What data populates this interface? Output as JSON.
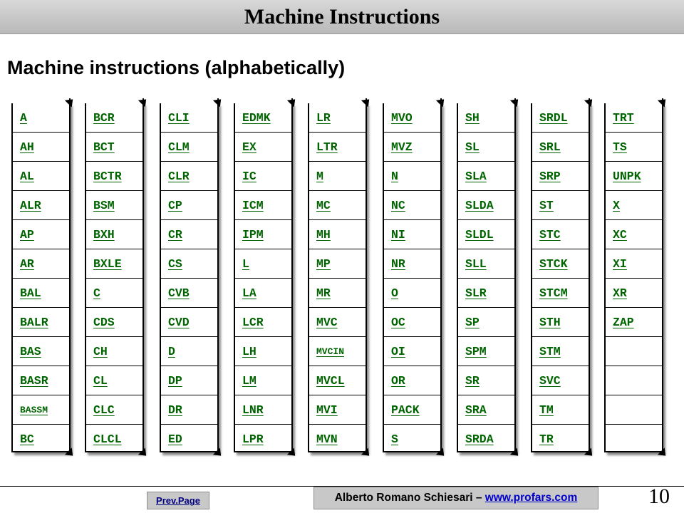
{
  "header": {
    "title": "Machine Instructions"
  },
  "subtitle": "Machine instructions (alphabetically)",
  "columns": [
    {
      "items": [
        "A",
        "AH",
        "AL",
        "ALR",
        "AP",
        "AR",
        "BAL",
        "BALR",
        "BAS",
        "BASR",
        "BASSM",
        "BC"
      ]
    },
    {
      "items": [
        "BCR",
        "BCT",
        "BCTR",
        "BSM",
        "BXH",
        "BXLE",
        "C",
        "CDS",
        "CH",
        "CL",
        "CLC",
        "CLCL"
      ]
    },
    {
      "items": [
        "CLI",
        "CLM",
        "CLR",
        "CP",
        "CR",
        "CS",
        "CVB",
        "CVD",
        "D",
        "DP",
        "DR",
        "ED"
      ]
    },
    {
      "items": [
        "EDMK",
        "EX",
        "IC",
        "ICM",
        "IPM",
        "L",
        "LA",
        "LCR",
        "LH",
        "LM",
        "LNR",
        "LPR"
      ]
    },
    {
      "items": [
        "LR",
        "LTR",
        "M",
        "MC",
        "MH",
        "MP",
        "MR",
        "MVC",
        "MVCIN",
        "MVCL",
        "MVI",
        "MVN"
      ]
    },
    {
      "items": [
        "MVO",
        "MVZ",
        "N",
        "NC",
        "NI",
        "NR",
        "O",
        "OC",
        "OI",
        "OR",
        "PACK",
        "S"
      ]
    },
    {
      "items": [
        "SH",
        "SL",
        "SLA",
        "SLDA",
        "SLDL",
        "SLL",
        "SLR",
        "SP",
        "SPM",
        "SR",
        "SRA",
        "SRDA"
      ]
    },
    {
      "items": [
        "SRDL",
        "SRL",
        "SRP",
        "ST",
        "STC",
        "STCK",
        "STCM",
        "STH",
        "STM",
        "SVC",
        "TM",
        "TR"
      ]
    },
    {
      "items": [
        "TRT",
        "TS",
        "UNPK",
        "X",
        "XC",
        "XI",
        "XR",
        "ZAP",
        "",
        "",
        "",
        ""
      ]
    }
  ],
  "footer": {
    "prev_label": "Prev.Page",
    "author": "Alberto Romano Schiesari – ",
    "website": "www.profars.com",
    "page_number": "10"
  },
  "colors": {
    "link": "#006400",
    "header_bg": "#c8c8c8",
    "author_link": "#0000cc"
  }
}
